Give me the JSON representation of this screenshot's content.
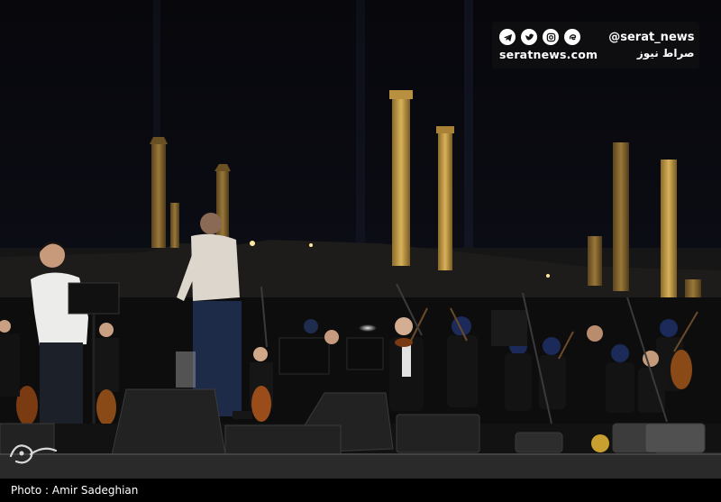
{
  "watermark": {
    "site": "seratnews.com",
    "handle": "@serat_news",
    "name_fa": "صراط نیوز",
    "icons": [
      "telegram-icon",
      "twitter-icon",
      "instagram-icon",
      "eitaa-icon"
    ]
  },
  "credit": {
    "text": "Photo : Amir Sadeghian"
  },
  "colors": {
    "sky": "#0a0a12",
    "pillar": "#c9a24a",
    "stage": "#1a1a1a",
    "shirt": "#e8e8e4"
  }
}
